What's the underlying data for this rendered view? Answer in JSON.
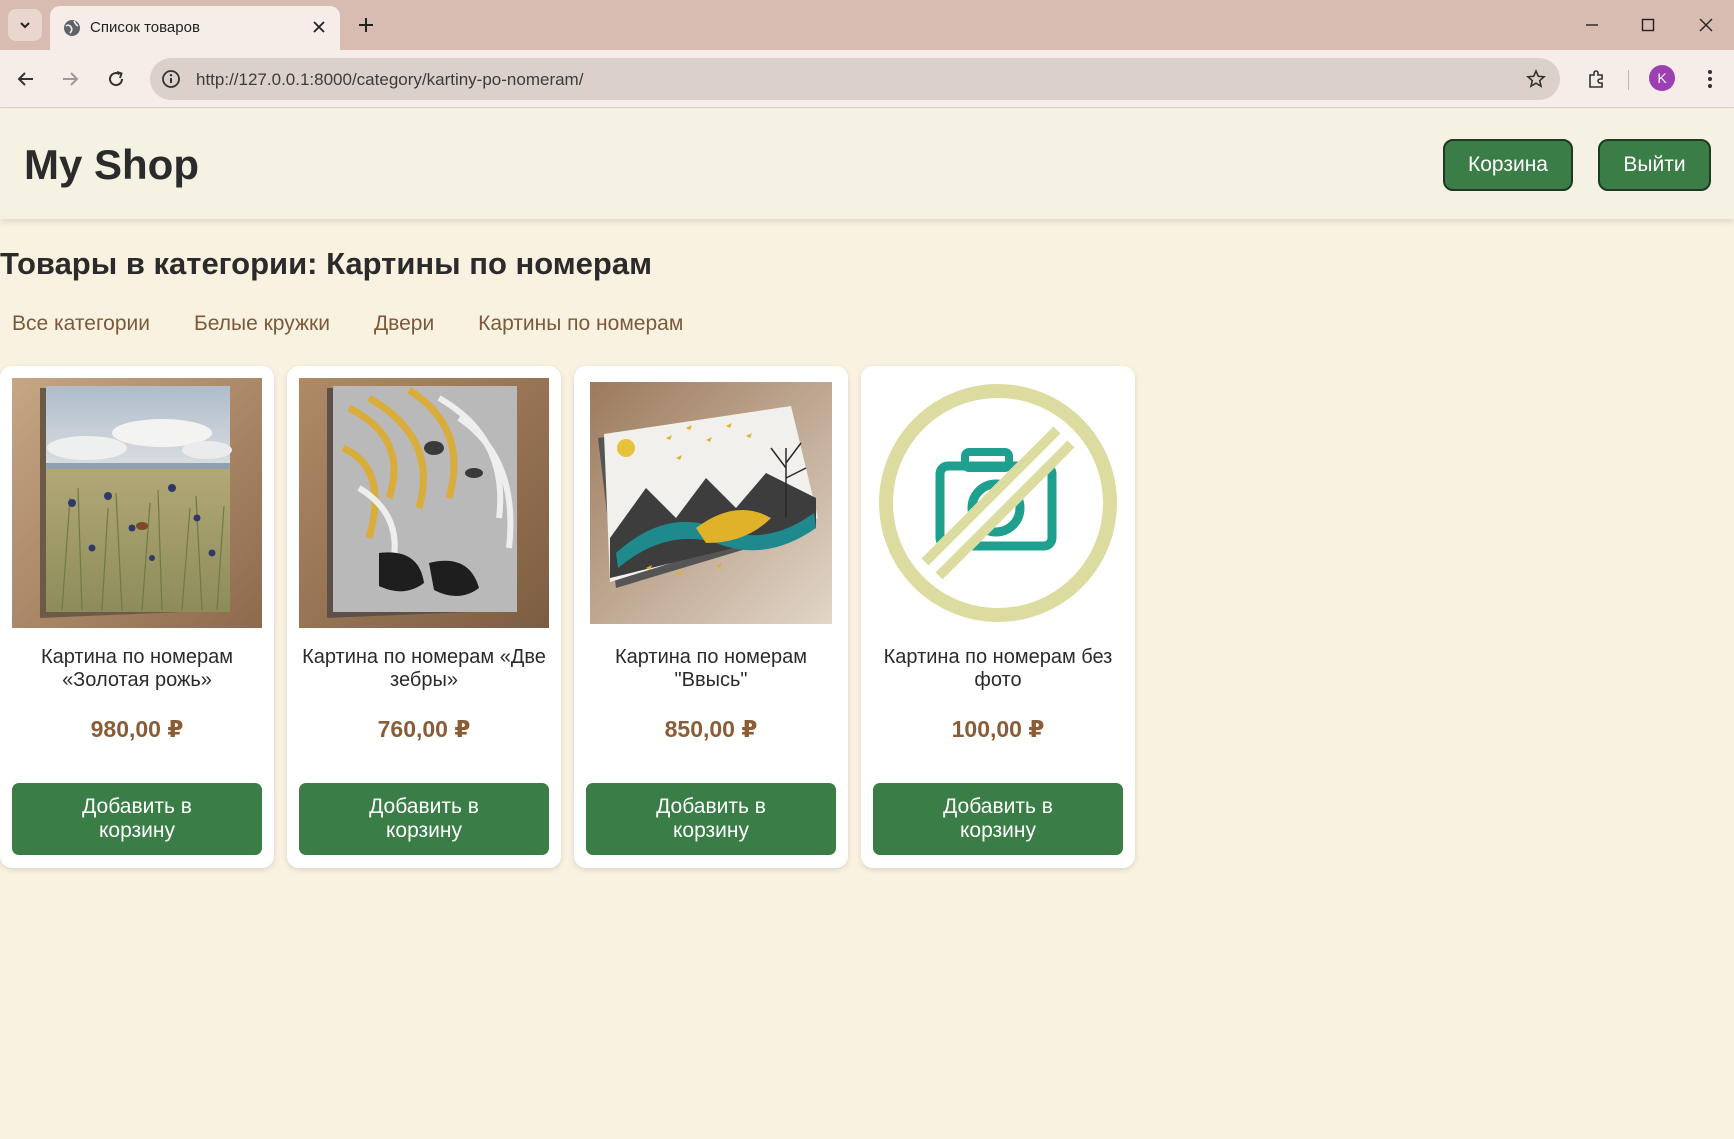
{
  "browser": {
    "tab_title": "Список товаров",
    "url": "http://127.0.0.1:8000/category/kartiny-po-nomeram/",
    "profile_initial": "K"
  },
  "header": {
    "logo": "My Shop",
    "cart_label": "Корзина",
    "logout_label": "Выйти"
  },
  "page": {
    "title": "Товары в категории: Картины по номерам"
  },
  "categories": [
    {
      "label": "Все категории"
    },
    {
      "label": "Белые кружки"
    },
    {
      "label": "Двери"
    },
    {
      "label": "Картины по номерам"
    }
  ],
  "products": [
    {
      "name": "Картина по номерам «Золотая рожь»",
      "price": "980,00 ₽",
      "button": "Добавить в корзину",
      "image": "painting-golden-rye"
    },
    {
      "name": "Картина по номерам «Две зебры»",
      "price": "760,00 ₽",
      "button": "Добавить в корзину",
      "image": "painting-two-zebras"
    },
    {
      "name": "Картина по номерам \"Ввысь\"",
      "price": "850,00 ₽",
      "button": "Добавить в корзину",
      "image": "painting-upward"
    },
    {
      "name": "Картина по номерам без фото",
      "price": "100,00 ₽",
      "button": "Добавить в корзину",
      "image": "no-photo-icon"
    }
  ],
  "colors": {
    "accent_green": "#3a7d46",
    "price_brown": "#8a5d36",
    "background": "#faf2e0"
  }
}
